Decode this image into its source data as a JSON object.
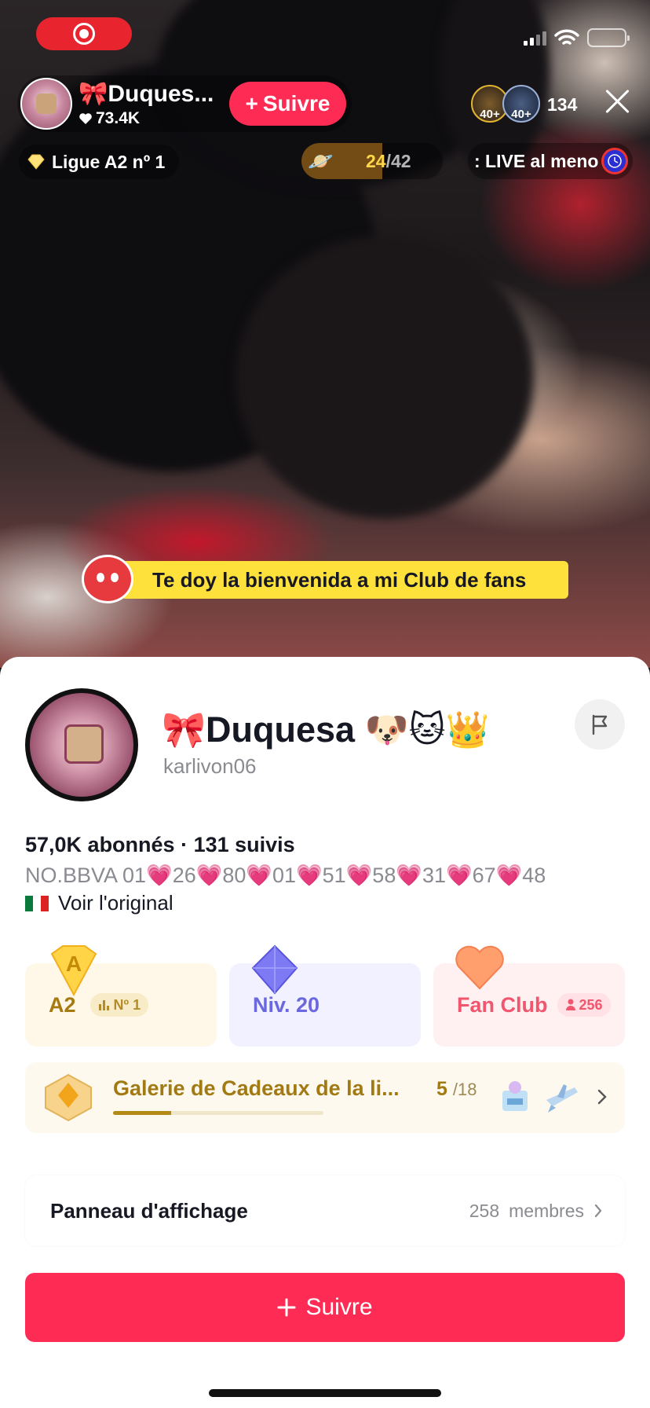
{
  "live": {
    "host_name": "🎀Duques...",
    "host_likes": "73.4K",
    "follow_label": "Suivre",
    "viewer_badge_1": "40+",
    "viewer_badge_2": "40+",
    "viewer_count": "134",
    "league_label": "Ligue A2 nº 1",
    "goal_current": "24",
    "goal_total": "/42",
    "goal_progress": 0.5714,
    "ticker_text": ": LIVE al meno",
    "welcome_banner": "Te doy la bienvenida a mi Club de fans"
  },
  "profile": {
    "display_name": "🎀Duquesa 🐶🐱👑",
    "handle": "karlivon06",
    "stats": "57,0K abonnés · 131 suivis",
    "bio": "NO.BBVA 01💗26💗80💗01💗51💗58💗31💗67💗48",
    "translate_label": "Voir l'original",
    "league_card": {
      "badge": "A",
      "label": "A2",
      "rank": "Nº 1"
    },
    "level_card": {
      "label": "Niv. 20"
    },
    "fan_card": {
      "label": "Fan Club",
      "count": "256"
    },
    "gallery": {
      "title": "Galerie de Cadeaux de la li...",
      "count": "5",
      "total": "/18",
      "progress": 0.2778
    },
    "board": {
      "title": "Panneau d'affichage",
      "members_count": "258",
      "members_label": "membres"
    },
    "follow_button": "Suivre"
  },
  "colors": {
    "accent": "#fe2c55",
    "league_gold": "#a67a10",
    "level_purple": "#6a67df",
    "fan_pink": "#f0566e",
    "banner_yellow": "#ffe13b"
  },
  "icons": [
    "record-icon",
    "signal-icon",
    "wifi-icon",
    "battery-icon",
    "heart-icon",
    "plus-icon",
    "close-icon",
    "diamond-icon",
    "planet-icon",
    "clock-icon",
    "flag-icon",
    "bar-chart-icon",
    "person-icon",
    "chevron-right-icon"
  ]
}
